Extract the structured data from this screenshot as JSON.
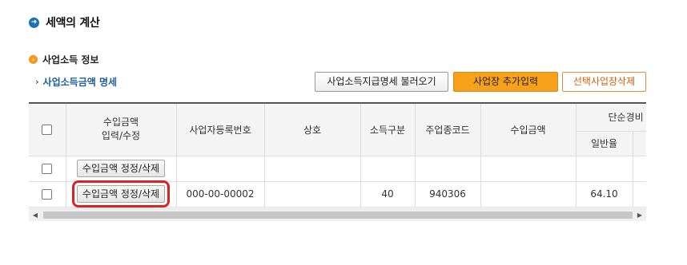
{
  "page": {
    "title": "세액의 계산",
    "title_icon": "arrow-right-circle-icon",
    "section_title": "사업소득 정보",
    "section_icon": "circle-bullet-icon",
    "detail_link": "사업소득금액 명세"
  },
  "toolbar": {
    "load_label": "사업소득지급명세 불러오기",
    "add_label": "사업장 추가입력",
    "delete_label": "선택사업장삭제"
  },
  "table": {
    "headers": {
      "income_input": "수입금액\n입력/수정",
      "reg_no": "사업자등록번호",
      "name": "상호",
      "income_type": "소득구분",
      "industry_code": "주업종코드",
      "income_amount": "수입금액",
      "simple_expense": "단순경비",
      "general_rate": "일반율"
    },
    "rows": [
      {
        "button": "수입금액 정정/삭제",
        "reg_no": "",
        "name": "",
        "income_type": "",
        "industry_code": "",
        "income_amount": "",
        "general_rate": ""
      },
      {
        "button": "수입금액 정정/삭제",
        "reg_no": "000-00-00002",
        "name": "",
        "income_type": "40",
        "industry_code": "940306",
        "income_amount": "",
        "general_rate": "64.10"
      }
    ]
  },
  "colors": {
    "accent_orange": "#f7a019",
    "highlight": "#e02020",
    "link_blue": "#1d5fa0"
  }
}
